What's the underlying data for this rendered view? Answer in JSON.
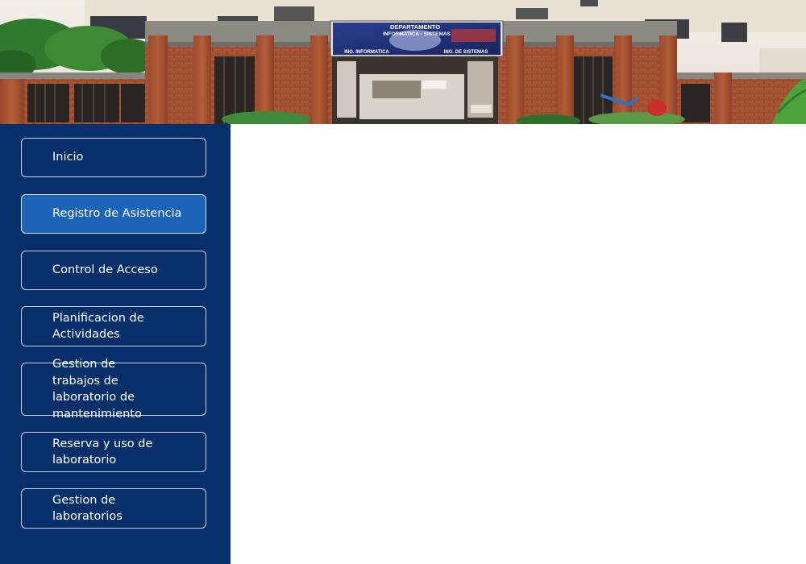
{
  "banner": {
    "sign_title": "DEPARTAMENTO",
    "sign_subtitle": "INFORMATICA - SISTEMAS",
    "sign_left": "ING. INFORMATICA",
    "sign_right": "ING. DE SISTEMAS"
  },
  "sidebar": {
    "items": [
      {
        "label": "Inicio",
        "active": false
      },
      {
        "label": "Registro de Asistencia",
        "active": true
      },
      {
        "label": "Control de Acceso",
        "active": false
      },
      {
        "label": "Planificacion de Actividades",
        "active": false
      },
      {
        "label": "Gestion de trabajos de laboratorio de mantenimiento",
        "active": false
      },
      {
        "label": "Reserva y uso de laboratorio",
        "active": false
      },
      {
        "label": "Gestion de laboratorios",
        "active": false
      }
    ]
  },
  "colors": {
    "sidebar_bg": "#07306a",
    "active_item_bg": "#1c64b8",
    "item_border": "#c9d3e4",
    "text": "#ffffff"
  }
}
